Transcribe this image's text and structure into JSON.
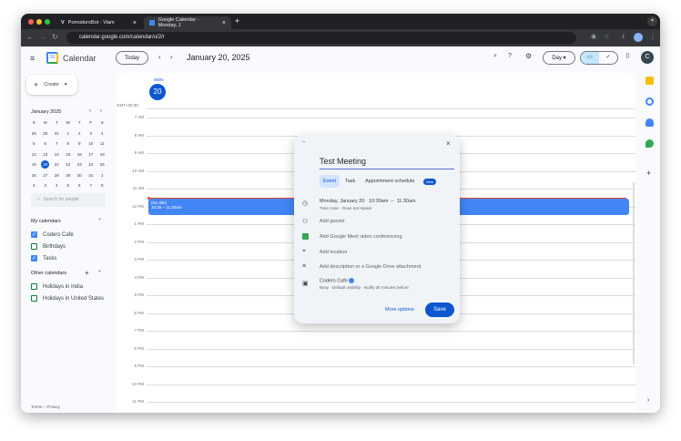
{
  "browser": {
    "tabs": [
      {
        "title": "PomodoroBot - Viam"
      },
      {
        "title": "Google Calendar - Monday, J"
      }
    ],
    "url": "calendar.google.com/calendar/u/2/r"
  },
  "header": {
    "app_name": "Calendar",
    "logo_day": "20",
    "today": "Today",
    "date_title": "January 20, 2025",
    "view": "Day",
    "avatar": "C"
  },
  "sidebar": {
    "create": "Create",
    "mini_cal": {
      "title": "January 2025",
      "weekdays": [
        "S",
        "M",
        "T",
        "W",
        "T",
        "F",
        "S"
      ],
      "weeks": [
        [
          "29",
          "30",
          "31",
          "1",
          "2",
          "3",
          "4"
        ],
        [
          "5",
          "6",
          "7",
          "8",
          "9",
          "10",
          "11"
        ],
        [
          "12",
          "13",
          "14",
          "15",
          "16",
          "17",
          "18"
        ],
        [
          "19",
          "20",
          "21",
          "22",
          "23",
          "24",
          "25"
        ],
        [
          "26",
          "27",
          "28",
          "29",
          "30",
          "31",
          "1"
        ],
        [
          "2",
          "3",
          "4",
          "5",
          "6",
          "7",
          "8"
        ]
      ],
      "selected": "20"
    },
    "search_placeholder": "Search for people",
    "my_calendars": {
      "title": "My calendars",
      "items": [
        {
          "label": "Coders Cafe",
          "checked": true,
          "color": "#4285f4"
        },
        {
          "label": "Birthdays",
          "checked": false,
          "color": "#0b8043"
        },
        {
          "label": "Tasks",
          "checked": true,
          "color": "#4285f4"
        }
      ]
    },
    "other_calendars": {
      "title": "Other calendars",
      "items": [
        {
          "label": "Holidays in India",
          "checked": false,
          "color": "#0b8043"
        },
        {
          "label": "Holidays in United States",
          "checked": false,
          "color": "#0b8043"
        }
      ]
    },
    "footer": "Terms – Privacy"
  },
  "day": {
    "weekday": "MON",
    "date": "20",
    "timezone": "GMT+05:30",
    "hours": [
      "7 AM",
      "8 AM",
      "9 AM",
      "10 AM",
      "11 AM",
      "12 PM",
      "1 PM",
      "2 PM",
      "3 PM",
      "4 PM",
      "5 PM",
      "6 PM",
      "7 PM",
      "8 PM",
      "9 PM",
      "10 PM",
      "11 PM"
    ],
    "event": {
      "title": "(No title)",
      "time": "10:30 – 11:30am",
      "color": "#4285f4"
    }
  },
  "popup": {
    "title": "Test Meeting",
    "tabs": [
      "Event",
      "Task",
      "Appointment schedule"
    ],
    "new_badge": "New",
    "date": "Monday, January 20",
    "start": "10:30am",
    "dash": "–",
    "end": "11:30am",
    "recurrence": "Time zone · Does not repeat",
    "add_guests": "Add guests",
    "meet": "Add Google Meet video conferencing",
    "location": "Add location",
    "description": "Add description or a Google Drive attachment",
    "calendar": "Coders Cafe",
    "calendar_details": "Busy · Default visibility · Notify 30 minutes before",
    "more_options": "More options",
    "save": "Save"
  }
}
